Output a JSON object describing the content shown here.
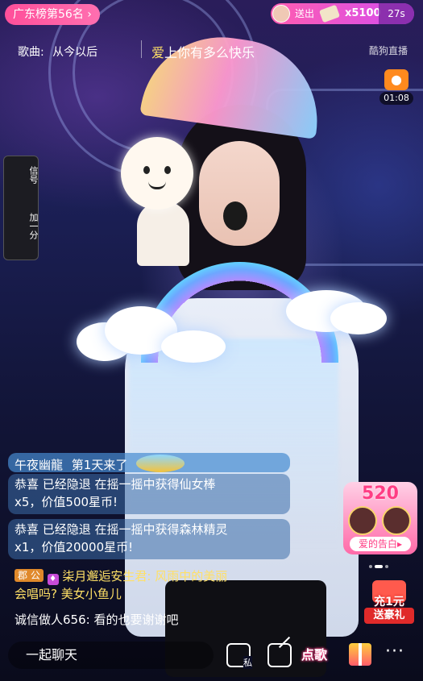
{
  "top": {
    "rank_label": "广东榜第56名",
    "rank_chevron": "›",
    "gift_banner": {
      "sent_label": "送出",
      "count": "x5100",
      "seconds": "27s"
    }
  },
  "song": {
    "label": "歌曲:",
    "title": "从今以后",
    "lyric_highlight": "爱",
    "lyric_rest": "上你有多么快乐"
  },
  "watermark": "酷狗直播",
  "timer": {
    "icon": "penguin-icon",
    "time": "01:08"
  },
  "side_button": {
    "line1": "信号",
    "line2": "加一分"
  },
  "chat": [
    {
      "user": "午夜幽龍",
      "text": "第1天来了"
    },
    {
      "line1": "恭喜 已经隐退 在摇一摇中获得仙女棒",
      "line2": "x5，价值500星币!"
    },
    {
      "line1": "恭喜 已经隐退 在摇一摇中获得森林精灵",
      "line2": "x1，价值20000星币!"
    },
    {
      "badge": "郡 公",
      "user": "柒月邂逅安生君",
      "text": ": 风雨中的美丽",
      "line2": "会唱吗? 美女小鱼儿"
    },
    {
      "user": "诚信做人656",
      "text": ": 看的也要谢谢吧"
    }
  ],
  "promo_520": {
    "number": "520",
    "label": "爱的告白▸"
  },
  "promo_recharge": {
    "top": "充1元",
    "bottom": "送豪礼"
  },
  "bottom": {
    "chat_placeholder": "一起聊天",
    "private_label": "私",
    "song_label": "点歌",
    "more": "···"
  }
}
